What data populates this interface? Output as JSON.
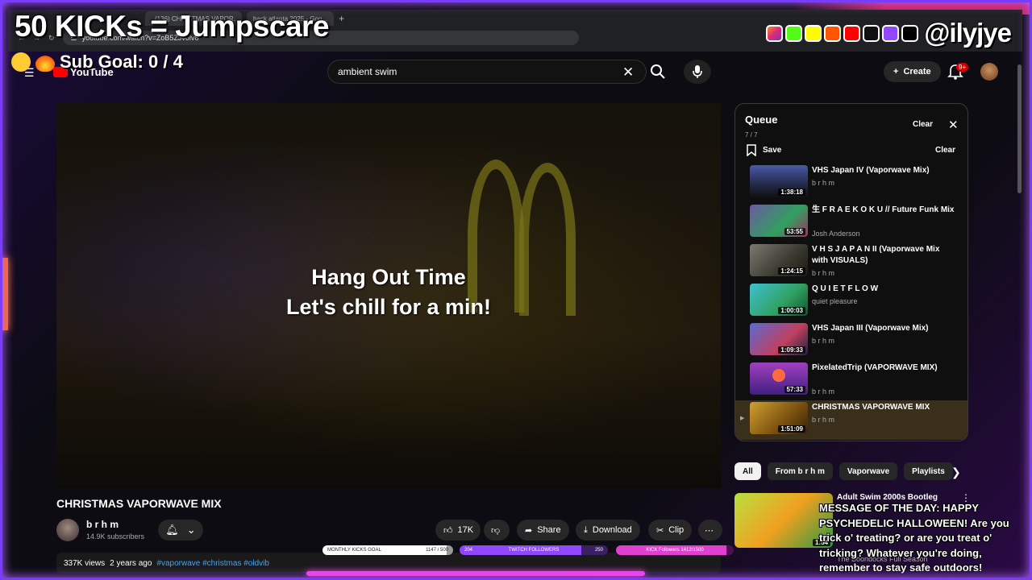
{
  "overlay": {
    "goal_title": "50 KICKs = Jumpscare",
    "sub_goal": "Sub Goal:  0 / 4",
    "handle": "@ilyjye",
    "message": "MESSAGE OF THE DAY: HAPPY PSYCHEDELIC HALLOWEEN! Are you trick o' treating? or are you treat o' tricking? Whatever you're doing, remember to stay safe outdoors!",
    "goals": {
      "kicks_label": "MONTHLY KICKS GOAL",
      "kicks_value": "1147 / 500",
      "twitch_left": "204",
      "twitch_label": "TWITCH FOLLOWERS",
      "twitch_right": "250",
      "kick_label": "KICK Followers 1412/1500"
    }
  },
  "browser": {
    "tab_label": "(136) CHRISTMAS VAPOR...",
    "tab2_label": "hack atlanta 2025 - Goo...",
    "url": "youtube.com/watch?v=ZoB5ZJvolv8"
  },
  "youtube": {
    "logo": "YouTube",
    "search_value": "ambient swim",
    "create_label": "Create",
    "notif_badge": "9+",
    "video": {
      "overlay_line1": "Hang Out Time",
      "overlay_line2": "Let's chill for a min!",
      "title": "CHRISTMAS VAPORWAVE MIX",
      "channel": "b r h m",
      "subscribers": "14.9K subscribers",
      "likes": "17K",
      "share": "Share",
      "download": "Download",
      "clip": "Clip",
      "views": "337K views",
      "age": "2 years ago",
      "tags": "#vaporwave #christmas #oldvib"
    },
    "queue": {
      "title": "Queue",
      "count": "7 / 7",
      "clear": "Clear",
      "save": "Save",
      "items": [
        {
          "title": "VHS Japan IV (Vaporwave Mix)",
          "channel": "b r h m",
          "duration": "1:38:18"
        },
        {
          "title": "生 F R A E K O K U // Future Funk Mix",
          "channel": "Josh Anderson",
          "duration": "53:55"
        },
        {
          "title": "V H S  J A P A N II (Vaporwave Mix with VISUALS)",
          "channel": "b r h m",
          "duration": "1:24:15"
        },
        {
          "title": "Q U I E T  F L O W",
          "channel": "quiet pleasure",
          "duration": "1:00:03"
        },
        {
          "title": "VHS Japan III (Vaporwave Mix)",
          "channel": "b r h m",
          "duration": "1:09:33"
        },
        {
          "title": "PixelatedTrip (VAPORWAVE MIX)",
          "channel": "b r h m",
          "duration": "57:33"
        },
        {
          "title": "CHRISTMAS VAPORWAVE MIX",
          "channel": "b r h m",
          "duration": "1:51:09"
        }
      ]
    },
    "chips": [
      "All",
      "From b r h m",
      "Vaporwave",
      "Playlists"
    ],
    "recommended": {
      "title": "Adult Swim 2000s Bootleg",
      "subtitle": "The Boondocks Full Season",
      "duration": "1:54"
    }
  }
}
